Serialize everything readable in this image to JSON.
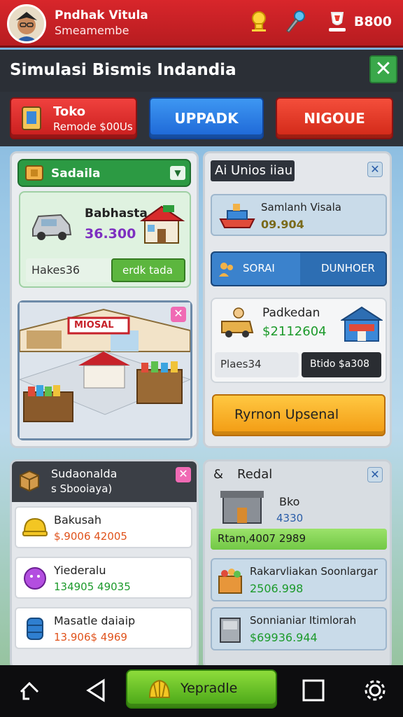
{
  "header": {
    "player_name": "Pndhak Vitula",
    "player_sub": "Smeamembe",
    "coins": "B800"
  },
  "title": "Simulasi Bismis Indandia",
  "top_buttons": {
    "toko_title": "Toko",
    "toko_sub": "Remode $00Us",
    "upgrade": "UPPADK",
    "nigoue": "NIGOUE"
  },
  "left_panel": {
    "header": "Sadaila",
    "card_title": "Babhasta",
    "card_value": "36.300",
    "card_stat_label": "Hakes36",
    "card_button": "erdk tada",
    "store_sign": "MIOSAL"
  },
  "right_panel": {
    "header": "Ai Unios iiau",
    "item1_title": "Samlanh Visala",
    "item1_value": "09.904",
    "tab_left": "SORAI",
    "tab_right": "DUNHOER",
    "item2_title": "Padkedan",
    "item2_value": "$2112604",
    "item2_stat": "Plaes34",
    "item2_button": "Btido $a308",
    "action_button": "Ryrnon Upsenal"
  },
  "bottom_left": {
    "title": "Sudaonalda",
    "subtitle": "s Sbooiaya)",
    "items": [
      {
        "name": "Bakusah",
        "value": "$.9006 42005",
        "value_color": "#e0531c"
      },
      {
        "name": "Yiederalu",
        "value": "134905 49035",
        "value_color": "#1c9a2b"
      },
      {
        "name": "Masatle daiaip",
        "value": "13.906$ 4969",
        "value_color": "#e0531c"
      }
    ]
  },
  "bottom_right": {
    "title": "Redal",
    "shop_name": "Bko",
    "shop_value": "4330",
    "bar_text": "Rtam,4007 2989",
    "items": [
      {
        "name": "Rakarvliakan Soonlargar",
        "value": "2506.998"
      },
      {
        "name": "Sonnianiar Itimlorah",
        "value": "$69936.944"
      }
    ]
  },
  "bottom_nav": {
    "upgrade_label": "Yepradle"
  },
  "colors": {
    "header_red": "#c62024",
    "accent_green": "#3aa84a",
    "blue_button": "#1d66d6",
    "action_orange": "#f7a219"
  }
}
